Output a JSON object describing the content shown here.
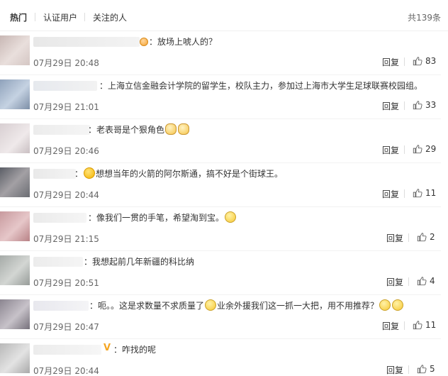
{
  "tabs": {
    "hot": "热门",
    "verified": "认证用户",
    "following": "关注的人",
    "total": "共139条"
  },
  "comments": [
    {
      "text": "：放场上唬人的？",
      "time": "07月29日 20:48",
      "reply": "回复",
      "likes": "83",
      "emoji": "yellow"
    },
    {
      "text": "：上海立信金融会计学院的留学生，校队主力，参加过上海市大学生足球联赛校园组。",
      "time": "07月29日 21:01",
      "reply": "回复",
      "likes": "33"
    },
    {
      "text": "：老表哥是个狠角色",
      "time": "07月29日 20:46",
      "reply": "回复",
      "likes": "29",
      "emoji": "cat"
    },
    {
      "text": "想想当年的火箭的阿尔斯通，搞不好是个街球王。",
      "time": "07月29日 20:44",
      "reply": "回复",
      "likes": "11",
      "emoji": "yellow"
    },
    {
      "text": "：像我们一贯的手笔，希望淘到宝。",
      "time": "07月29日 21:15",
      "reply": "回复",
      "likes": "2",
      "emoji": "laugh"
    },
    {
      "text": "：我想起前几年新疆的科比纳",
      "time": "07月29日 20:51",
      "reply": "回复",
      "likes": "4"
    },
    {
      "text_a": "：呃。。这是求数量不求质量了",
      "text_b": "业余外援我们这一抓一大把，用不用推荐？",
      "time": "07月29日 20:47",
      "reply": "回复",
      "likes": "11",
      "emoji": "laugh"
    },
    {
      "text": "：咋找的呢",
      "time": "07月29日 20:44",
      "reply": "回复",
      "likes": "5",
      "badge": "V"
    }
  ],
  "colors": {
    "text": "#333333",
    "muted": "#666666",
    "divider": "#f2f2f2"
  },
  "icons": {
    "like": "thumbs-up-icon"
  }
}
